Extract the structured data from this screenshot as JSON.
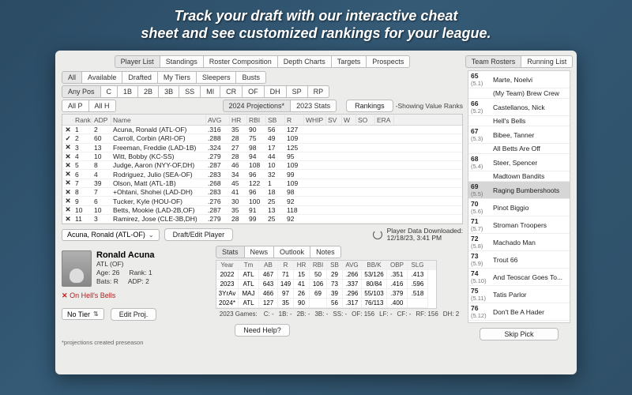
{
  "hero_line1": "Track your draft with our interactive cheat",
  "hero_line2": "sheet and see customized rankings for your league.",
  "top_tabs": [
    "Player List",
    "Standings",
    "Roster Composition",
    "Depth Charts",
    "Targets",
    "Prospects"
  ],
  "top_tabs_selected": 0,
  "filter_row1": [
    "All",
    "Available",
    "Drafted",
    "My Tiers",
    "Sleepers",
    "Busts"
  ],
  "filter_row1_selected": 0,
  "pos_filters": [
    "Any Pos",
    "C",
    "1B",
    "2B",
    "3B",
    "SS",
    "MI",
    "CR",
    "OF",
    "DH",
    "SP",
    "RP"
  ],
  "pos_selected": 0,
  "scope_filters": [
    "All P",
    "All H"
  ],
  "proj_toggle": [
    "2024 Projections*",
    "2023 Stats"
  ],
  "proj_selected": 0,
  "rankings_btn": "Rankings",
  "rankings_note": "-Showing Value Ranks",
  "cols": [
    "",
    "Rank",
    "ADP",
    "Name",
    "AVG",
    "HR",
    "RBI",
    "SB",
    "R",
    "WHIP",
    "SV",
    "W",
    "SO",
    "ERA"
  ],
  "rows": [
    {
      "mk": "x",
      "rank": 1,
      "adp": 2,
      "name": "Acuna, Ronald (ATL-OF)",
      "avg": ".316",
      "hr": 35,
      "rbi": 90,
      "sb": 56,
      "r": 127
    },
    {
      "mk": "c",
      "rank": 2,
      "adp": 60,
      "name": "Carroll, Corbin (ARI-OF)",
      "avg": ".288",
      "hr": 28,
      "rbi": 75,
      "sb": 49,
      "r": 109
    },
    {
      "mk": "x",
      "rank": 3,
      "adp": 13,
      "name": "Freeman, Freddie (LAD-1B)",
      "avg": ".324",
      "hr": 27,
      "rbi": 98,
      "sb": 17,
      "r": 125
    },
    {
      "mk": "x",
      "rank": 4,
      "adp": 10,
      "name": "Witt, Bobby (KC-SS)",
      "avg": ".279",
      "hr": 28,
      "rbi": 94,
      "sb": 44,
      "r": 95
    },
    {
      "mk": "x",
      "rank": 5,
      "adp": 8,
      "name": "Judge, Aaron (NYY-OF,DH)",
      "avg": ".287",
      "hr": 46,
      "rbi": 108,
      "sb": 10,
      "r": 109
    },
    {
      "mk": "x",
      "rank": 6,
      "adp": 4,
      "name": "Rodriguez, Julio (SEA-OF)",
      "avg": ".283",
      "hr": 34,
      "rbi": 96,
      "sb": 32,
      "r": 99
    },
    {
      "mk": "x",
      "rank": 7,
      "adp": 39,
      "name": "Olson, Matt (ATL-1B)",
      "avg": ".268",
      "hr": 45,
      "rbi": 122,
      "sb": 1,
      "r": 109
    },
    {
      "mk": "x",
      "rank": 8,
      "adp": 7,
      "name": "+Ohtani, Shohei (LAD-DH)",
      "avg": ".283",
      "hr": 41,
      "rbi": 96,
      "sb": 18,
      "r": 98
    },
    {
      "mk": "x",
      "rank": 9,
      "adp": 6,
      "name": "Tucker, Kyle (HOU-OF)",
      "avg": ".276",
      "hr": 30,
      "rbi": 100,
      "sb": 25,
      "r": 92
    },
    {
      "mk": "x",
      "rank": 10,
      "adp": 10,
      "name": "Betts, Mookie (LAD-2B,OF)",
      "avg": ".287",
      "hr": 35,
      "rbi": 91,
      "sb": 13,
      "r": 118
    },
    {
      "mk": "x",
      "rank": 11,
      "adp": 3,
      "name": "Ramirez, Jose (CLE-3B,DH)",
      "avg": ".279",
      "hr": 28,
      "rbi": 99,
      "sb": 25,
      "r": 92
    }
  ],
  "selected_player_dd": "Acuna, Ronald (ATL-OF)",
  "draft_btn": "Draft/Edit Player",
  "download_label": "Player Data Downloaded:",
  "download_ts": "12/18/23, 3:41 PM",
  "player_card": {
    "name": "Ronald Acuna",
    "team_pos": "ATL  (OF)",
    "age": "Age: 26",
    "bats": "Bats: R",
    "rank": "Rank: 1",
    "adp": "ADP: 2",
    "on_team": "On Hell's Bells"
  },
  "tier_dd": "No Tier",
  "edit_proj_btn": "Edit Proj.",
  "detail_tabs": [
    "Stats",
    "News",
    "Outlook",
    "Notes"
  ],
  "stat_cols": [
    "Year",
    "Tm",
    "AB",
    "R",
    "HR",
    "RBI",
    "SB",
    "AVG",
    "BB/K",
    "OBP",
    "SLG"
  ],
  "stat_rows": [
    {
      "y": "2022",
      "tm": "ATL",
      "ab": "467",
      "r": "71",
      "hr": "15",
      "rbi": "50",
      "sb": "29",
      "avg": ".266",
      "bbk": "53/126",
      "obp": ".351",
      "slg": ".413"
    },
    {
      "y": "2023",
      "tm": "ATL",
      "ab": "643",
      "r": "149",
      "hr": "41",
      "rbi": "106",
      "sb": "73",
      "avg": ".337",
      "bbk": "80/84",
      "obp": ".416",
      "slg": ".596"
    },
    {
      "y": "3YrAv",
      "tm": "MAJ",
      "ab": "466",
      "r": "97",
      "hr": "26",
      "rbi": "69",
      "sb": "39",
      "avg": ".296",
      "bbk": "55/103",
      "obp": ".379",
      "slg": ".518"
    },
    {
      "y": "2024*",
      "tm": "ATL",
      "ab": "127",
      "r": "35",
      "hr": "90",
      "rbi": "",
      "sb": "56",
      "avg": ".317",
      "bbk": "76/113",
      "obp": ".400",
      "slg": ""
    }
  ],
  "games_label": "2023 Games:",
  "pos_games": [
    "C: -",
    "1B: -",
    "2B: -",
    "3B: -",
    "SS: -",
    "OF: 156",
    "LF: -",
    "CF: -",
    "RF: 156",
    "DH: 2"
  ],
  "need_help": "Need Help?",
  "footnote": "*projections created preseason",
  "side_tabs": [
    "Team Rosters",
    "Running List"
  ],
  "side_tabs_selected": 0,
  "skip_btn": "Skip Pick",
  "roster": [
    {
      "rk": "65",
      "sub": "(5.1)",
      "nm": "Marte, Noelvi"
    },
    {
      "rk": "",
      "sub": "",
      "nm": "(My Team) Brew Crew"
    },
    {
      "rk": "66",
      "sub": "(5.2)",
      "nm": "Castellanos, Nick"
    },
    {
      "rk": "",
      "sub": "",
      "nm": "Hell's Bells"
    },
    {
      "rk": "67",
      "sub": "(5.3)",
      "nm": "Bibee, Tanner"
    },
    {
      "rk": "",
      "sub": "",
      "nm": "All Betts Are Off"
    },
    {
      "rk": "68",
      "sub": "(5.4)",
      "nm": "Steer, Spencer"
    },
    {
      "rk": "",
      "sub": "",
      "nm": "Madtown Bandits"
    },
    {
      "rk": "69",
      "sub": "(5.5)",
      "nm": "Raging Bumbershoots",
      "hl": true
    },
    {
      "rk": "70",
      "sub": "(5.6)",
      "nm": "Pinot Biggio"
    },
    {
      "rk": "71",
      "sub": "(5.7)",
      "nm": "Stroman Troopers"
    },
    {
      "rk": "72",
      "sub": "(5.8)",
      "nm": "Machado Man"
    },
    {
      "rk": "73",
      "sub": "(5.9)",
      "nm": "Trout 66"
    },
    {
      "rk": "74",
      "sub": "(5.10)",
      "nm": "And Teoscar Goes To..."
    },
    {
      "rk": "75",
      "sub": "(5.11)",
      "nm": "Tatis Parlor"
    },
    {
      "rk": "76",
      "sub": "(5.12)",
      "nm": "Don't Be A Hader"
    }
  ]
}
